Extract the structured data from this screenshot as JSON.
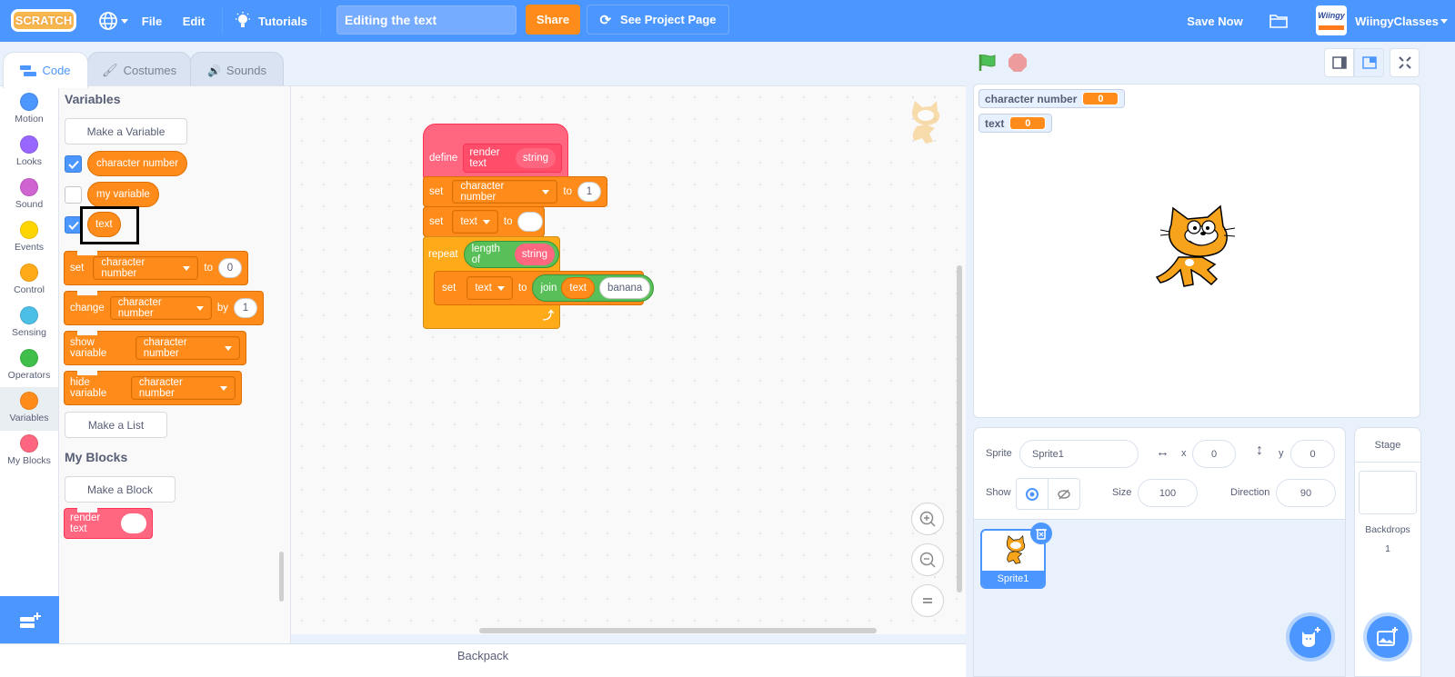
{
  "menubar": {
    "logo": "SCRATCH",
    "file": "File",
    "edit": "Edit",
    "tutorials": "Tutorials",
    "project_title": "Editing the text",
    "share": "Share",
    "see_project_page": "See Project Page",
    "save_now": "Save Now",
    "username": "WiingyClasses",
    "avatar_text": "Wiingy"
  },
  "tabs": [
    {
      "label": "Code",
      "active": true
    },
    {
      "label": "Costumes",
      "active": false
    },
    {
      "label": "Sounds",
      "active": false
    }
  ],
  "categories": [
    {
      "label": "Motion",
      "color": "#4c97ff"
    },
    {
      "label": "Looks",
      "color": "#9966ff"
    },
    {
      "label": "Sound",
      "color": "#cf63cf"
    },
    {
      "label": "Events",
      "color": "#ffd500"
    },
    {
      "label": "Control",
      "color": "#ffab19"
    },
    {
      "label": "Sensing",
      "color": "#4cbfe6"
    },
    {
      "label": "Operators",
      "color": "#40bf4a"
    },
    {
      "label": "Variables",
      "color": "#ff8c1a",
      "selected": true
    },
    {
      "label": "My Blocks",
      "color": "#ff6680"
    }
  ],
  "palette": {
    "variables_heading": "Variables",
    "make_variable": "Make a Variable",
    "variables": [
      {
        "name": "character number",
        "checked": true
      },
      {
        "name": "my variable",
        "checked": false
      },
      {
        "name": "text",
        "checked": true,
        "highlighted": true
      }
    ],
    "set_block": {
      "label": "set",
      "var": "character number",
      "to": "to",
      "value": "0"
    },
    "change_block": {
      "label": "change",
      "var": "character number",
      "by": "by",
      "value": "1"
    },
    "show_block": {
      "label": "show variable",
      "var": "character number"
    },
    "hide_block": {
      "label": "hide variable",
      "var": "character number"
    },
    "make_list": "Make a List",
    "myblocks_heading": "My Blocks",
    "make_block": "Make a Block",
    "render_text_block": "render text"
  },
  "script": {
    "define": "define",
    "define_name": "render text",
    "define_param": "string",
    "set1": {
      "label": "set",
      "var": "character number",
      "to": "to",
      "value": "1"
    },
    "set2": {
      "label": "set",
      "var": "text",
      "to": "to",
      "value": ""
    },
    "repeat": {
      "label": "repeat",
      "op": "length of",
      "arg": "string"
    },
    "set3": {
      "label": "set",
      "var": "text",
      "to": "to",
      "join": "join",
      "join_a": "text",
      "join_b": "banana"
    }
  },
  "stage": {
    "monitors": [
      {
        "name": "character number",
        "value": "0"
      },
      {
        "name": "text",
        "value": "0"
      }
    ]
  },
  "sprite_info": {
    "sprite_label": "Sprite",
    "sprite_name": "Sprite1",
    "x_label": "x",
    "x_value": "0",
    "y_label": "y",
    "y_value": "0",
    "show_label": "Show",
    "size_label": "Size",
    "size_value": "100",
    "direction_label": "Direction",
    "direction_value": "90"
  },
  "sprites": [
    {
      "name": "Sprite1",
      "selected": true
    }
  ],
  "stage_pane": {
    "title": "Stage",
    "backdrops_label": "Backdrops",
    "backdrops_count": "1"
  },
  "backpack": "Backpack",
  "colors": {
    "accent": "#4c97ff",
    "variables": "#ff8c1a",
    "myblocks": "#ff6680",
    "operators": "#59c059",
    "control": "#ffab19"
  }
}
